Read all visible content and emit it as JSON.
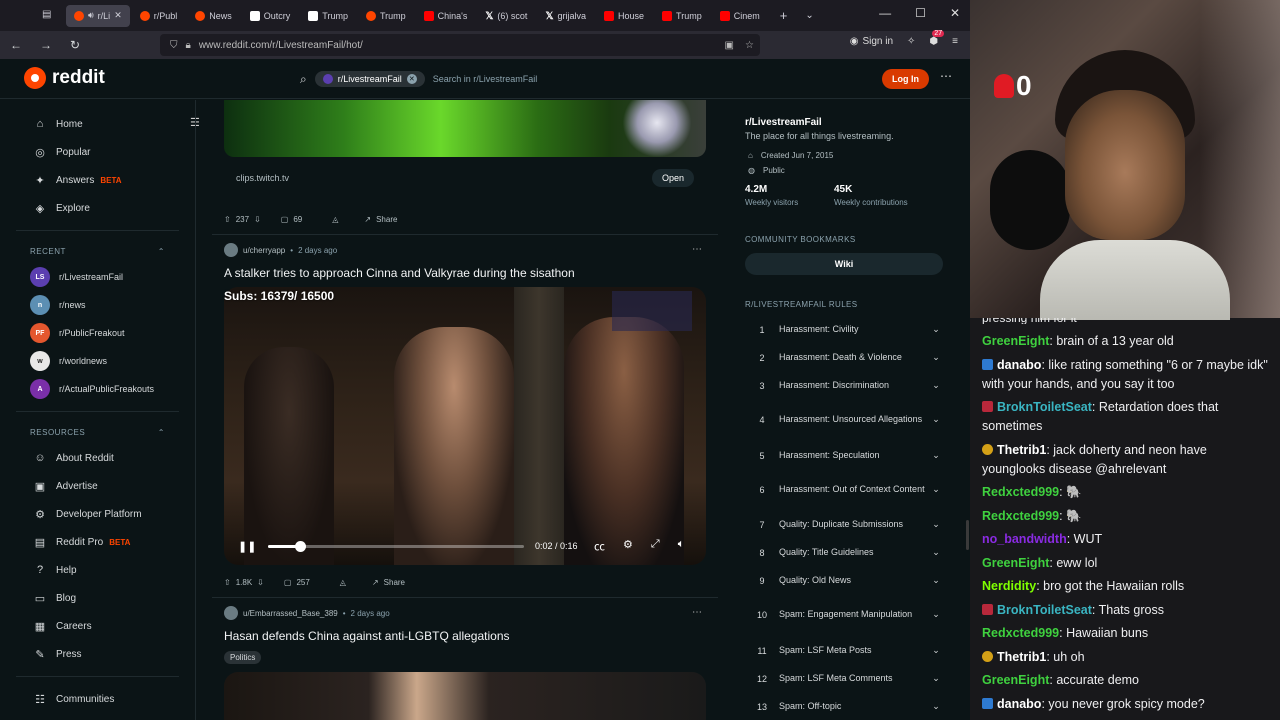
{
  "browser": {
    "tabs": [
      {
        "label": "r/Li",
        "fav": "red",
        "active": true
      },
      {
        "label": "r/Publ",
        "fav": "red"
      },
      {
        "label": "News",
        "fav": "red"
      },
      {
        "label": "Outcry",
        "fav": "sq"
      },
      {
        "label": "Trump",
        "fav": "sq"
      },
      {
        "label": "Trump",
        "fav": "red"
      },
      {
        "label": "China's",
        "fav": "yt"
      },
      {
        "label": "(6) scot",
        "fav": "x"
      },
      {
        "label": "grijalva",
        "fav": "x"
      },
      {
        "label": "House",
        "fav": "yt"
      },
      {
        "label": "Trump",
        "fav": "yt"
      },
      {
        "label": "Cinem",
        "fav": "yt"
      }
    ],
    "url": "www.reddit.com/r/LivestreamFail/hot/",
    "sign_in": "Sign in",
    "extension_badge": "27"
  },
  "header": {
    "logo_text": "reddit",
    "sub_chip": "r/LivestreamFail",
    "search_placeholder": "Search in r/LivestreamFail",
    "login_label": "Log In"
  },
  "sidebar": {
    "nav": [
      {
        "label": "Home",
        "icon": "home-icon",
        "glyph": "⌂"
      },
      {
        "label": "Popular",
        "icon": "popular-icon",
        "glyph": "◎"
      },
      {
        "label": "Answers",
        "icon": "answers-icon",
        "glyph": "✦",
        "beta": "BETA"
      },
      {
        "label": "Explore",
        "icon": "explore-icon",
        "glyph": "◈"
      }
    ],
    "recent_heading": "RECENT",
    "recent": [
      {
        "label": "r/LivestreamFail",
        "color": "#5b3fb0",
        "abbr": "LS"
      },
      {
        "label": "r/news",
        "color": "#5c8fb3",
        "abbr": "n"
      },
      {
        "label": "r/PublicFreakout",
        "color": "#e4572e",
        "abbr": "PF"
      },
      {
        "label": "r/worldnews",
        "color": "#e8e8e8",
        "abbr": "w"
      },
      {
        "label": "r/ActualPublicFreakouts",
        "color": "#7a2fa8",
        "abbr": "A"
      }
    ],
    "resources_heading": "RESOURCES",
    "resources": [
      {
        "label": "About Reddit",
        "icon": "about-icon",
        "glyph": "☺"
      },
      {
        "label": "Advertise",
        "icon": "advertise-icon",
        "glyph": "▣"
      },
      {
        "label": "Developer Platform",
        "icon": "developer-icon",
        "glyph": "⚙"
      },
      {
        "label": "Reddit Pro",
        "icon": "reddit-pro-icon",
        "glyph": "▤",
        "beta": "BETA"
      },
      {
        "label": "Help",
        "icon": "help-icon",
        "glyph": "?"
      },
      {
        "label": "Blog",
        "icon": "blog-icon",
        "glyph": "▭"
      },
      {
        "label": "Careers",
        "icon": "careers-icon",
        "glyph": "▦"
      },
      {
        "label": "Press",
        "icon": "press-icon",
        "glyph": "✎"
      }
    ],
    "communities": "Communities"
  },
  "feed": {
    "link_domain": "clips.twitch.tv",
    "open_label": "Open",
    "post1_votes": "237",
    "post1_comments": "69",
    "share_label": "Share",
    "post2": {
      "author": "u/cherryapp",
      "age": "2 days ago",
      "title": "A stalker tries to approach Cinna and Valkyrae during the sisathon",
      "overlay_text": "Subs: 16379/ 16500",
      "time": "0:02 / 0:16",
      "progress": 0.125,
      "votes": "1.8K",
      "comments": "257"
    },
    "post3": {
      "author": "u/Embarrassed_Base_389",
      "age": "2 days ago",
      "title": "Hasan defends China against anti-LGBTQ allegations",
      "flair": "Politics"
    }
  },
  "right": {
    "title": "r/LivestreamFail",
    "desc": "The place for all things livestreaming.",
    "created": "Created Jun 7, 2015",
    "visibility": "Public",
    "visitors_value": "4.2M",
    "visitors_label": "Weekly visitors",
    "contrib_value": "45K",
    "contrib_label": "Weekly contributions",
    "bookmarks_heading": "COMMUNITY BOOKMARKS",
    "wiki": "Wiki",
    "rules_heading": "R/LIVESTREAMFAIL RULES",
    "rules": [
      {
        "n": "1",
        "t": "Harassment: Civility"
      },
      {
        "n": "2",
        "t": "Harassment: Death & Violence"
      },
      {
        "n": "3",
        "t": "Harassment: Discrimination"
      },
      {
        "n": "4",
        "t": "Harassment: Unsourced Allegations"
      },
      {
        "n": "5",
        "t": "Harassment: Speculation"
      },
      {
        "n": "6",
        "t": "Harassment: Out of Context Content"
      },
      {
        "n": "7",
        "t": "Quality: Duplicate Submissions"
      },
      {
        "n": "8",
        "t": "Quality: Title Guidelines"
      },
      {
        "n": "9",
        "t": "Quality: Old News"
      },
      {
        "n": "10",
        "t": "Spam: Engagement Manipulation"
      },
      {
        "n": "11",
        "t": "Spam: LSF Meta Posts"
      },
      {
        "n": "12",
        "t": "Spam: LSF Meta Comments"
      },
      {
        "n": "13",
        "t": "Spam: Off-topic"
      }
    ]
  },
  "stream": {
    "viewer_count": "0",
    "chat_top_fragment": "pressing him for it",
    "chat": [
      {
        "user": "GreenEight",
        "color": "#3fd13f",
        "badge": "",
        "text": ": brain of a 13 year old"
      },
      {
        "user": "danabo",
        "color": "#ffffff",
        "badge": "#2e7ad1",
        "text": ": like rating something \"6 or 7 maybe idk\" with your hands, and you say it too"
      },
      {
        "user": "BroknToiletSeat",
        "color": "#3ab5c2",
        "badge": "#b8283b",
        "text": ": Retardation does that sometimes"
      },
      {
        "user": "Thetrib1",
        "color": "#ffffff",
        "badge": "#d4a017",
        "text": ": jack doherty and neon have younglooks disease @ahrelevant"
      },
      {
        "user": "Redxcted999",
        "color": "#3fd13f",
        "badge": "",
        "text": ": 🐘"
      },
      {
        "user": "Redxcted999",
        "color": "#3fd13f",
        "badge": "",
        "text": ": 🐘"
      },
      {
        "user": "no_bandwidth",
        "color": "#8a2be2",
        "badge": "",
        "text": ": WUT"
      },
      {
        "user": "GreenEight",
        "color": "#3fd13f",
        "badge": "",
        "text": ": eww lol"
      },
      {
        "user": "Nerdidity",
        "color": "#7fff00",
        "badge": "",
        "text": ": bro got the Hawaiian rolls"
      },
      {
        "user": "BroknToiletSeat",
        "color": "#3ab5c2",
        "badge": "#b8283b",
        "text": ": Thats gross"
      },
      {
        "user": "Redxcted999",
        "color": "#3fd13f",
        "badge": "",
        "text": ": Hawaiian buns"
      },
      {
        "user": "Thetrib1",
        "color": "#ffffff",
        "badge": "#d4a017",
        "text": ": uh oh"
      },
      {
        "user": "GreenEight",
        "color": "#3fd13f",
        "badge": "",
        "text": ": accurate demo"
      },
      {
        "user": "danabo",
        "color": "#ffffff",
        "badge": "#2e7ad1",
        "text": ": you never grok spicy mode?"
      }
    ]
  }
}
